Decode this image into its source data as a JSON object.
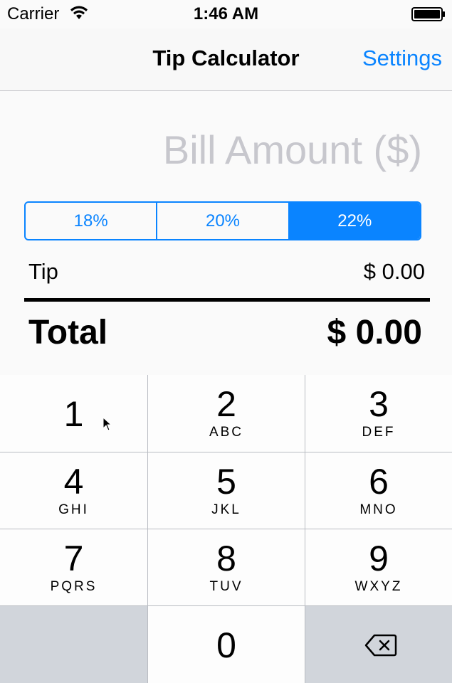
{
  "status_bar": {
    "carrier": "Carrier",
    "time": "1:46 AM",
    "wifi_icon": "wifi-icon",
    "battery_icon": "battery-icon"
  },
  "nav": {
    "title": "Tip Calculator",
    "settings_label": "Settings"
  },
  "bill": {
    "placeholder": "Bill Amount ($)",
    "value": ""
  },
  "tip_options": {
    "segments": [
      "18%",
      "20%",
      "22%"
    ],
    "selected": "22%"
  },
  "tip": {
    "label": "Tip",
    "value": "$ 0.00"
  },
  "total": {
    "label": "Total",
    "value": "$ 0.00"
  },
  "keypad": {
    "keys": [
      {
        "digit": "1",
        "letters": ""
      },
      {
        "digit": "2",
        "letters": "ABC"
      },
      {
        "digit": "3",
        "letters": "DEF"
      },
      {
        "digit": "4",
        "letters": "GHI"
      },
      {
        "digit": "5",
        "letters": "JKL"
      },
      {
        "digit": "6",
        "letters": "MNO"
      },
      {
        "digit": "7",
        "letters": "PQRS"
      },
      {
        "digit": "8",
        "letters": "TUV"
      },
      {
        "digit": "9",
        "letters": "WXYZ"
      },
      {
        "digit": "0",
        "letters": ""
      }
    ],
    "delete_icon": "backspace-icon"
  },
  "colors": {
    "accent": "#0a84ff",
    "placeholder": "#c7c7cd",
    "keypad_dark": "#d1d5db"
  }
}
